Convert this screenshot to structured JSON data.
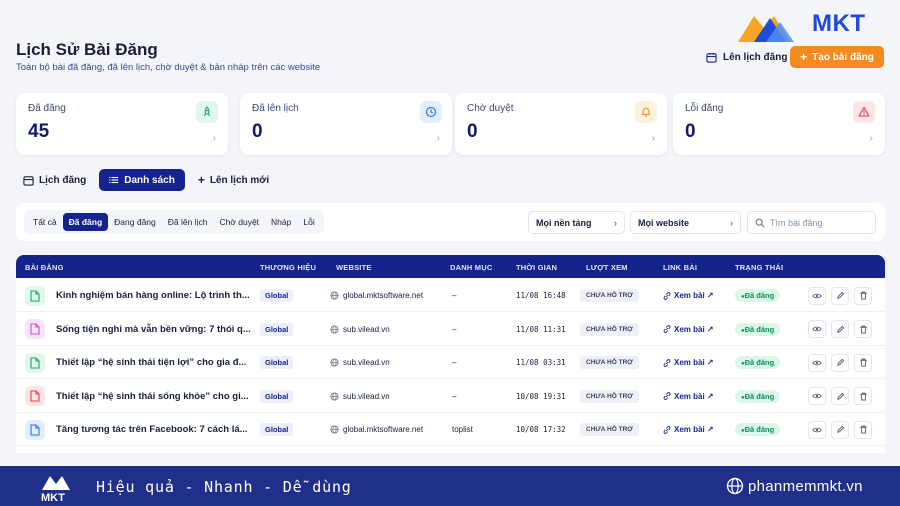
{
  "header": {
    "title": "Lịch Sử Bài Đăng",
    "subtitle": "Toàn bộ bài đã đăng, đã lên lịch, chờ duyệt & bản nháp trên các website",
    "logo_text": "MKT",
    "schedule_label": "Lên lịch đăng",
    "create_label": "Tạo bài đăng"
  },
  "stats": [
    {
      "label": "Đã đăng",
      "value": "45",
      "icon": "rocket-icon",
      "color": "#1fa36b",
      "bg": "#e3f6ec"
    },
    {
      "label": "Đã lên lịch",
      "value": "0",
      "icon": "clock-icon",
      "color": "#2b7bd9",
      "bg": "#e2eefc"
    },
    {
      "label": "Chờ duyệt",
      "value": "0",
      "icon": "bell-icon",
      "color": "#e8951a",
      "bg": "#fdf1dc"
    },
    {
      "label": "Lỗi đăng",
      "value": "0",
      "icon": "warning-icon",
      "color": "#e0424a",
      "bg": "#fde5e6"
    }
  ],
  "view_tabs": [
    {
      "label": "Lịch đăng",
      "icon": "calendar-icon"
    },
    {
      "label": "Danh sách",
      "icon": "list-icon"
    },
    {
      "label": "Lên lịch mới",
      "icon": "plus-icon"
    }
  ],
  "filter_tabs": [
    "Tất cả",
    "Đã đăng",
    "Đang đăng",
    "Đã lên lịch",
    "Chờ duyệt",
    "Nháp",
    "Lỗi"
  ],
  "filters": {
    "platform": "Mọi nền tảng",
    "website": "Mọi website",
    "search_placeholder": "Tìm bài đăng"
  },
  "table": {
    "columns": [
      "BÀI ĐĂNG",
      "THƯƠNG HIỆU",
      "WEBSITE",
      "DANH MỤC",
      "THỜI GIAN",
      "LƯỢT XEM",
      "LINK BÀI",
      "TRẠNG THÁI"
    ],
    "rows": [
      {
        "title": "Kinh nghiệm bán hàng online: Lộ trình th...",
        "brand": "Global",
        "website": "global.mktsoftware.net",
        "category": "–",
        "time": "11/08 16:48",
        "views": "CHƯA HỖ TRỢ",
        "link": "Xem bài ↗",
        "status": "Đã đăng",
        "icon_color": "#1fa36b",
        "icon_bg": "#e3f6ec"
      },
      {
        "title": "Sống tiện nghi mà vẫn bền vững: 7 thói q...",
        "brand": "Global",
        "website": "sub.vilead.vn",
        "category": "–",
        "time": "11/08 11:31",
        "views": "CHƯA HỖ TRỢ",
        "link": "Xem bài ↗",
        "status": "Đã đăng",
        "icon_color": "#c64bd1",
        "icon_bg": "#f8e4fa"
      },
      {
        "title": "Thiết lập “hệ sinh thái tiện lợi” cho gia đ...",
        "brand": "Global",
        "website": "sub.vilead.vn",
        "category": "–",
        "time": "11/08 03:31",
        "views": "CHƯA HỖ TRỢ",
        "link": "Xem bài ↗",
        "status": "Đã đăng",
        "icon_color": "#1fa36b",
        "icon_bg": "#e3f6ec"
      },
      {
        "title": "Thiết lập “hệ sinh thái sống khỏe” cho gi...",
        "brand": "Global",
        "website": "sub.vilead.vn",
        "category": "–",
        "time": "10/08 19:31",
        "views": "CHƯA HỖ TRỢ",
        "link": "Xem bài ↗",
        "status": "Đã đăng",
        "icon_color": "#e0424a",
        "icon_bg": "#fde5e6"
      },
      {
        "title": "Tăng tương tác trên Facebook: 7 cách lá...",
        "brand": "Global",
        "website": "global.mktsoftware.net",
        "category": "toplist",
        "time": "10/08 17:32",
        "views": "CHƯA HỖ TRỢ",
        "link": "Xem bài ↗",
        "status": "Đã đăng",
        "icon_color": "#2b7bd9",
        "icon_bg": "#e2eefc"
      }
    ]
  },
  "footer": {
    "tagline": "Hiệu quả - Nhanh - Dễ dùng",
    "site": "phanmemmkt.vn",
    "logo_text": "MKT"
  }
}
